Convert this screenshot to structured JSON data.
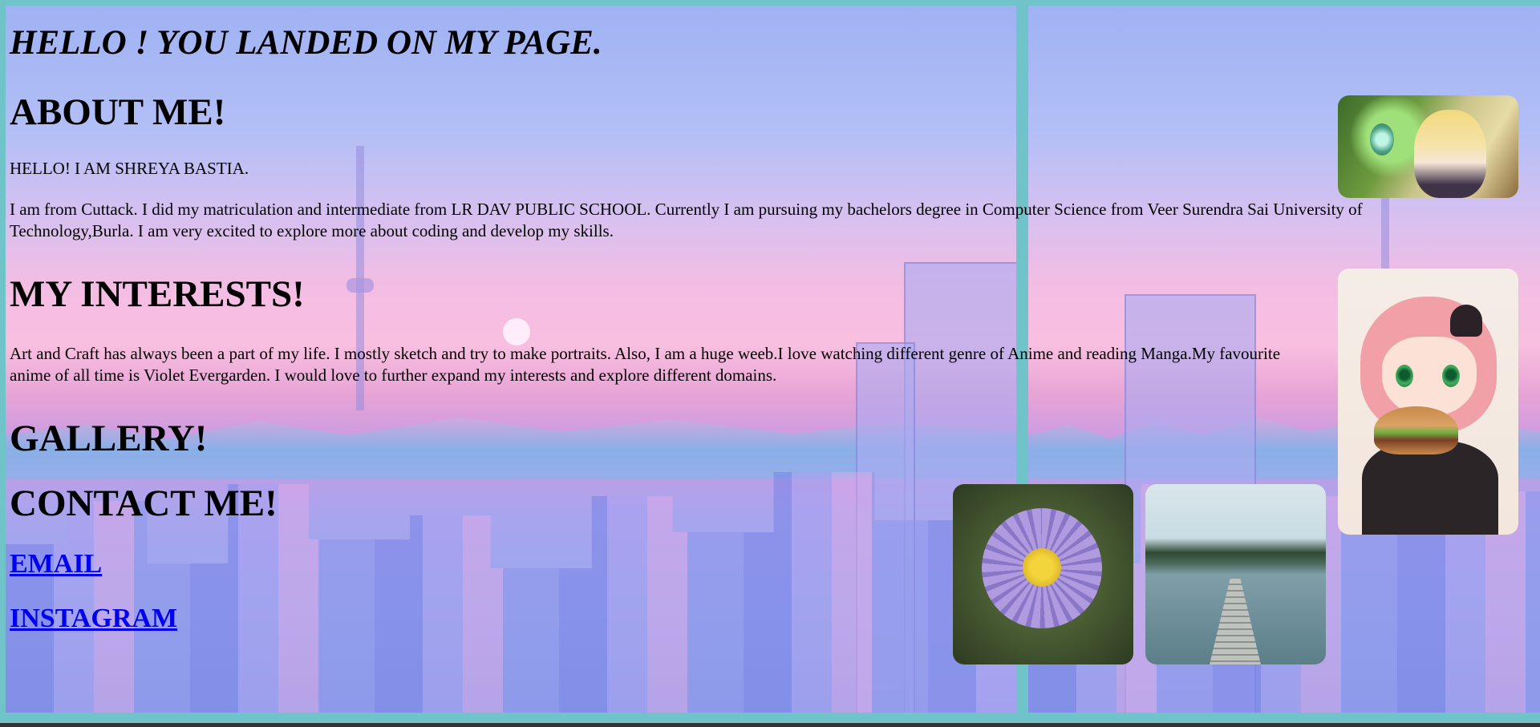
{
  "page": {
    "heading": "HELLO ! YOU LANDED ON MY PAGE."
  },
  "about": {
    "title": "ABOUT ME!",
    "intro": "HELLO! I AM SHREYA BASTIA.",
    "text": "I am from Cuttack. I did my matriculation and intermediate from LR DAV PUBLIC SCHOOL. Currently I am pursuing my bachelors degree in Computer Science from Veer Surendra Sai University of Technology,Burla. I am very excited to explore more about coding and develop my skills."
  },
  "interests": {
    "title": "MY INTERESTS!",
    "text": "Art and Craft has always been a part of my life. I mostly sketch and try to make portraits. Also, I am a huge weeb.I love watching different genre of Anime and reading Manga.My favourite anime of all time is Violet Evergarden. I would love to further expand my interests and explore different domains."
  },
  "gallery": {
    "title": "GALLERY!",
    "images": [
      "violet-evergarden-image",
      "anya-eating-burger-image",
      "purple-flower-image",
      "lake-pier-image"
    ]
  },
  "contact": {
    "title": "CONTACT ME!",
    "email_label": "EMAIL",
    "instagram_label": "INSTAGRAM"
  },
  "colors": {
    "frame": "#6fc3c9",
    "link": "#0000ee"
  }
}
